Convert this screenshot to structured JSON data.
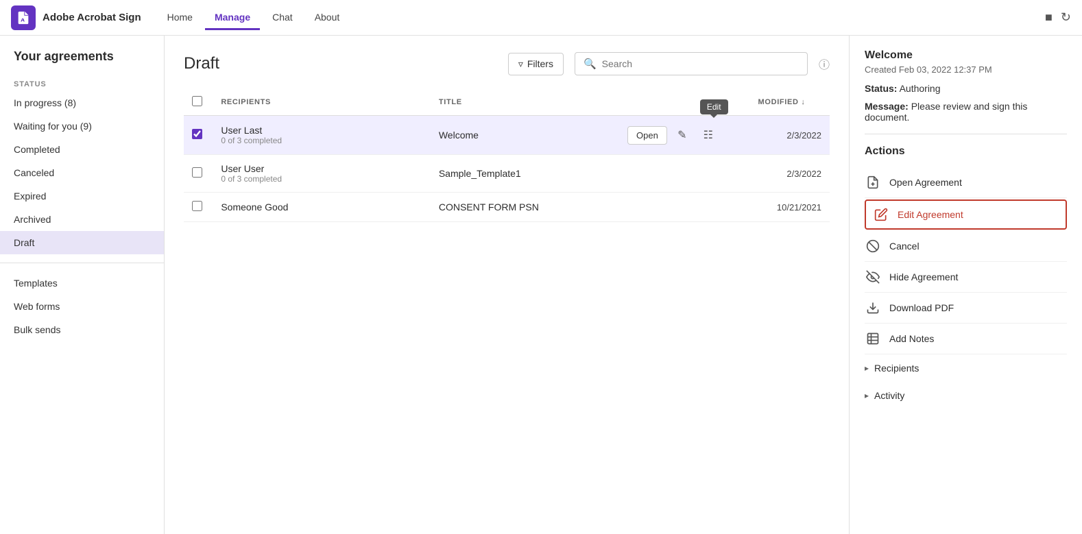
{
  "app": {
    "brand": "Adobe Acrobat Sign",
    "nav": {
      "links": [
        "Home",
        "Manage",
        "Chat",
        "About"
      ],
      "active": "Manage"
    }
  },
  "sidebar": {
    "title": "Your agreements",
    "section_label": "STATUS",
    "status_items": [
      {
        "label": "In progress (8)",
        "id": "in-progress"
      },
      {
        "label": "Waiting for you (9)",
        "id": "waiting"
      },
      {
        "label": "Completed",
        "id": "completed"
      },
      {
        "label": "Canceled",
        "id": "canceled"
      },
      {
        "label": "Expired",
        "id": "expired"
      },
      {
        "label": "Archived",
        "id": "archived"
      },
      {
        "label": "Draft",
        "id": "draft",
        "active": true
      }
    ],
    "other_items": [
      {
        "label": "Templates",
        "id": "templates"
      },
      {
        "label": "Web forms",
        "id": "web-forms"
      },
      {
        "label": "Bulk sends",
        "id": "bulk-sends"
      }
    ]
  },
  "main": {
    "title": "Draft",
    "filters_label": "Filters",
    "search_placeholder": "Search",
    "table": {
      "columns": [
        {
          "label": "",
          "id": "check"
        },
        {
          "label": "Recipients",
          "id": "recipients"
        },
        {
          "label": "Title",
          "id": "title"
        },
        {
          "label": "",
          "id": "actions"
        },
        {
          "label": "Modified ↓",
          "id": "modified"
        }
      ],
      "rows": [
        {
          "id": "row-1",
          "recipients_name": "User Last",
          "recipients_sub": "0 of 3 completed",
          "title": "Welcome",
          "modified": "2/3/2022",
          "selected": true,
          "show_actions": true
        },
        {
          "id": "row-2",
          "recipients_name": "User User",
          "recipients_sub": "0 of 3 completed",
          "title": "Sample_Template1",
          "modified": "2/3/2022",
          "selected": false,
          "show_actions": false
        },
        {
          "id": "row-3",
          "recipients_name": "Someone Good",
          "recipients_sub": "",
          "title": "CONSENT FORM PSN",
          "modified": "10/21/2021",
          "selected": false,
          "show_actions": false
        }
      ]
    }
  },
  "right_panel": {
    "title": "Welcome",
    "created": "Created Feb 03, 2022 12:37 PM",
    "status_label": "Status:",
    "status_value": "Authoring",
    "message_label": "Message:",
    "message_value": "Please review and sign this document.",
    "actions_title": "Actions",
    "actions": [
      {
        "label": "Open Agreement",
        "icon": "doc-icon",
        "id": "open-agreement"
      },
      {
        "label": "Edit Agreement",
        "icon": "edit-icon",
        "id": "edit-agreement",
        "highlighted": true
      },
      {
        "label": "Cancel",
        "icon": "cancel-icon",
        "id": "cancel"
      },
      {
        "label": "Hide Agreement",
        "icon": "hide-icon",
        "id": "hide-agreement"
      },
      {
        "label": "Download PDF",
        "icon": "download-icon",
        "id": "download-pdf"
      },
      {
        "label": "Add Notes",
        "icon": "notes-icon",
        "id": "add-notes"
      }
    ],
    "collapsibles": [
      {
        "label": "Recipients",
        "id": "recipients-section"
      },
      {
        "label": "Activity",
        "id": "activity-section"
      }
    ]
  },
  "tooltip": {
    "edit": "Edit"
  }
}
